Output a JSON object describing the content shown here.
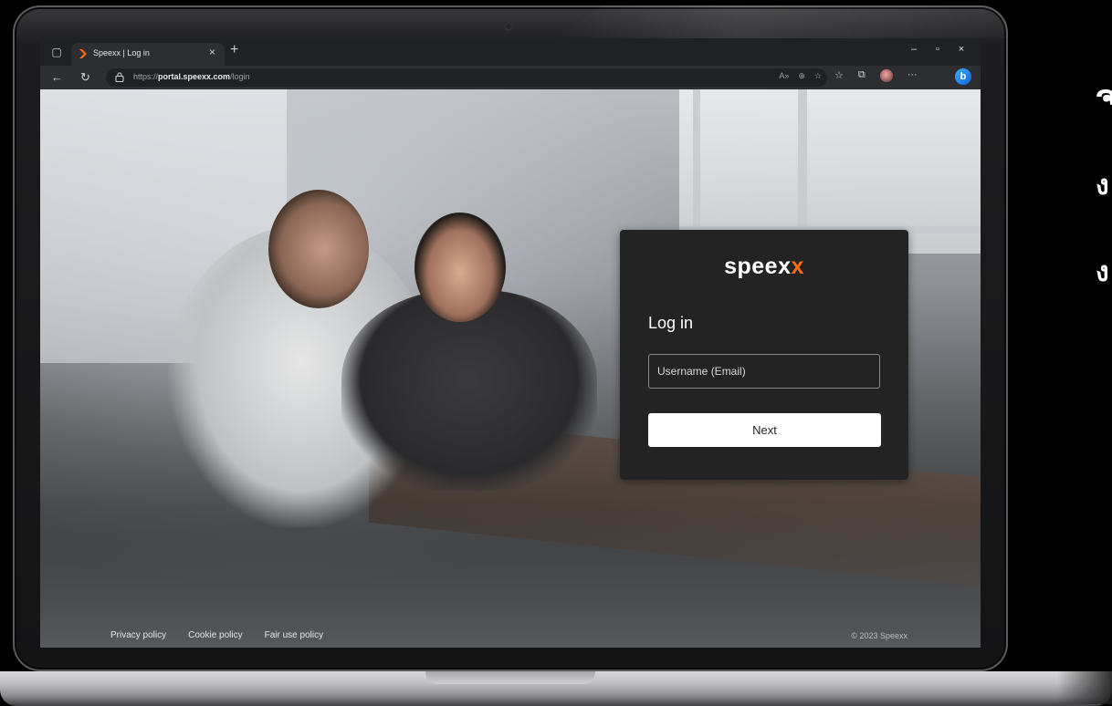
{
  "browser": {
    "tab_title": "Speexx | Log in",
    "tab_close": "×",
    "new_tab": "+",
    "window_controls": [
      "–",
      "▫",
      "×"
    ],
    "url_protocol": "https://",
    "url_host": "portal.speexx.com",
    "url_path": "/login",
    "read_aloud": "A»",
    "more_menu": "···"
  },
  "login": {
    "logo_main": "speex",
    "logo_accent": "x",
    "title": "Log in",
    "username_placeholder": "Username (Email)",
    "next_label": "Next"
  },
  "footer": {
    "links": [
      "Privacy policy",
      "Cookie policy",
      "Fair use policy"
    ],
    "copyright": "© 2023 Speexx"
  },
  "side_glyphs": [
    "ຈ",
    "ง",
    "ง"
  ],
  "colors": {
    "accent": "#ff6a13",
    "card_bg": "#232323",
    "browser_chrome": "#202124"
  }
}
